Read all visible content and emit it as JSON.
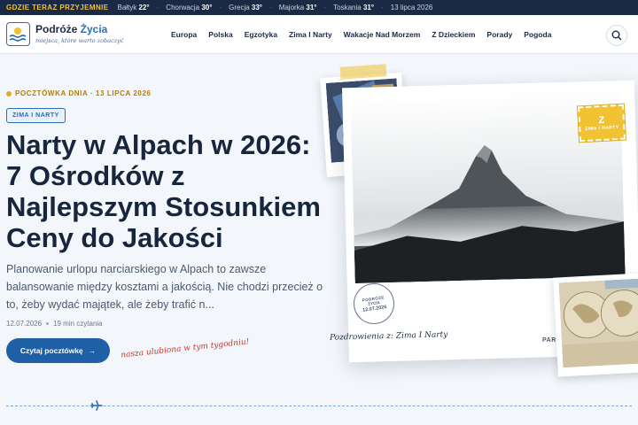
{
  "topbar": {
    "lead": "GDZIE TERAZ PRZYJEMNIE",
    "weather": [
      {
        "place": "Bałtyk",
        "temp": "22°"
      },
      {
        "place": "Chorwacja",
        "temp": "30°"
      },
      {
        "place": "Grecja",
        "temp": "33°"
      },
      {
        "place": "Majorka",
        "temp": "31°"
      },
      {
        "place": "Toskania",
        "temp": "31°"
      }
    ],
    "date": "13 lipca 2026"
  },
  "header": {
    "logo_title_a": "Podróże ",
    "logo_title_b": "Życia",
    "logo_sub": "miejsca, które warto zobaczyć",
    "nav": [
      "Europa",
      "Polska",
      "Egzotyka",
      "Zima I Narty",
      "Wakacje Nad Morzem",
      "Z Dzieckiem",
      "Porady",
      "Pogoda"
    ]
  },
  "hero": {
    "kicker": "POCZTÓWKA DNIA · 13 LIPCA 2026",
    "tag": "ZIMA I NARTY",
    "headline": "Narty w Alpach w 2026: 7 Ośrodków z Najlepszym Stosunkiem Ceny do Jakości",
    "lede": "Planowanie urlopu narciarskiego w Alpach to zawsze balansowanie między kosztami a jakością. Nie chodzi przecież o to, żeby wydać majątek, ale żeby trafić n...",
    "date": "12.07.2026",
    "read_time": "19 min czytania",
    "cta": "Czytaj pocztówkę",
    "favorite_note": "nasza ulubiona w tym tygodniu!"
  },
  "postcard": {
    "stamp_letter": "Z",
    "stamp_label": "ZIMA I NARTY",
    "postmark_a": "PODRÓŻE",
    "postmark_b": "ŻYCIA",
    "postmark_date": "12.07.2026",
    "greeting": "Pozdrowienia z: Zima I Narty",
    "side_label": "PAR"
  },
  "colors": {
    "navy": "#1b2a44",
    "accent_blue": "#1f5fa5",
    "gold": "#f1c232",
    "red_note": "#c0392b"
  }
}
